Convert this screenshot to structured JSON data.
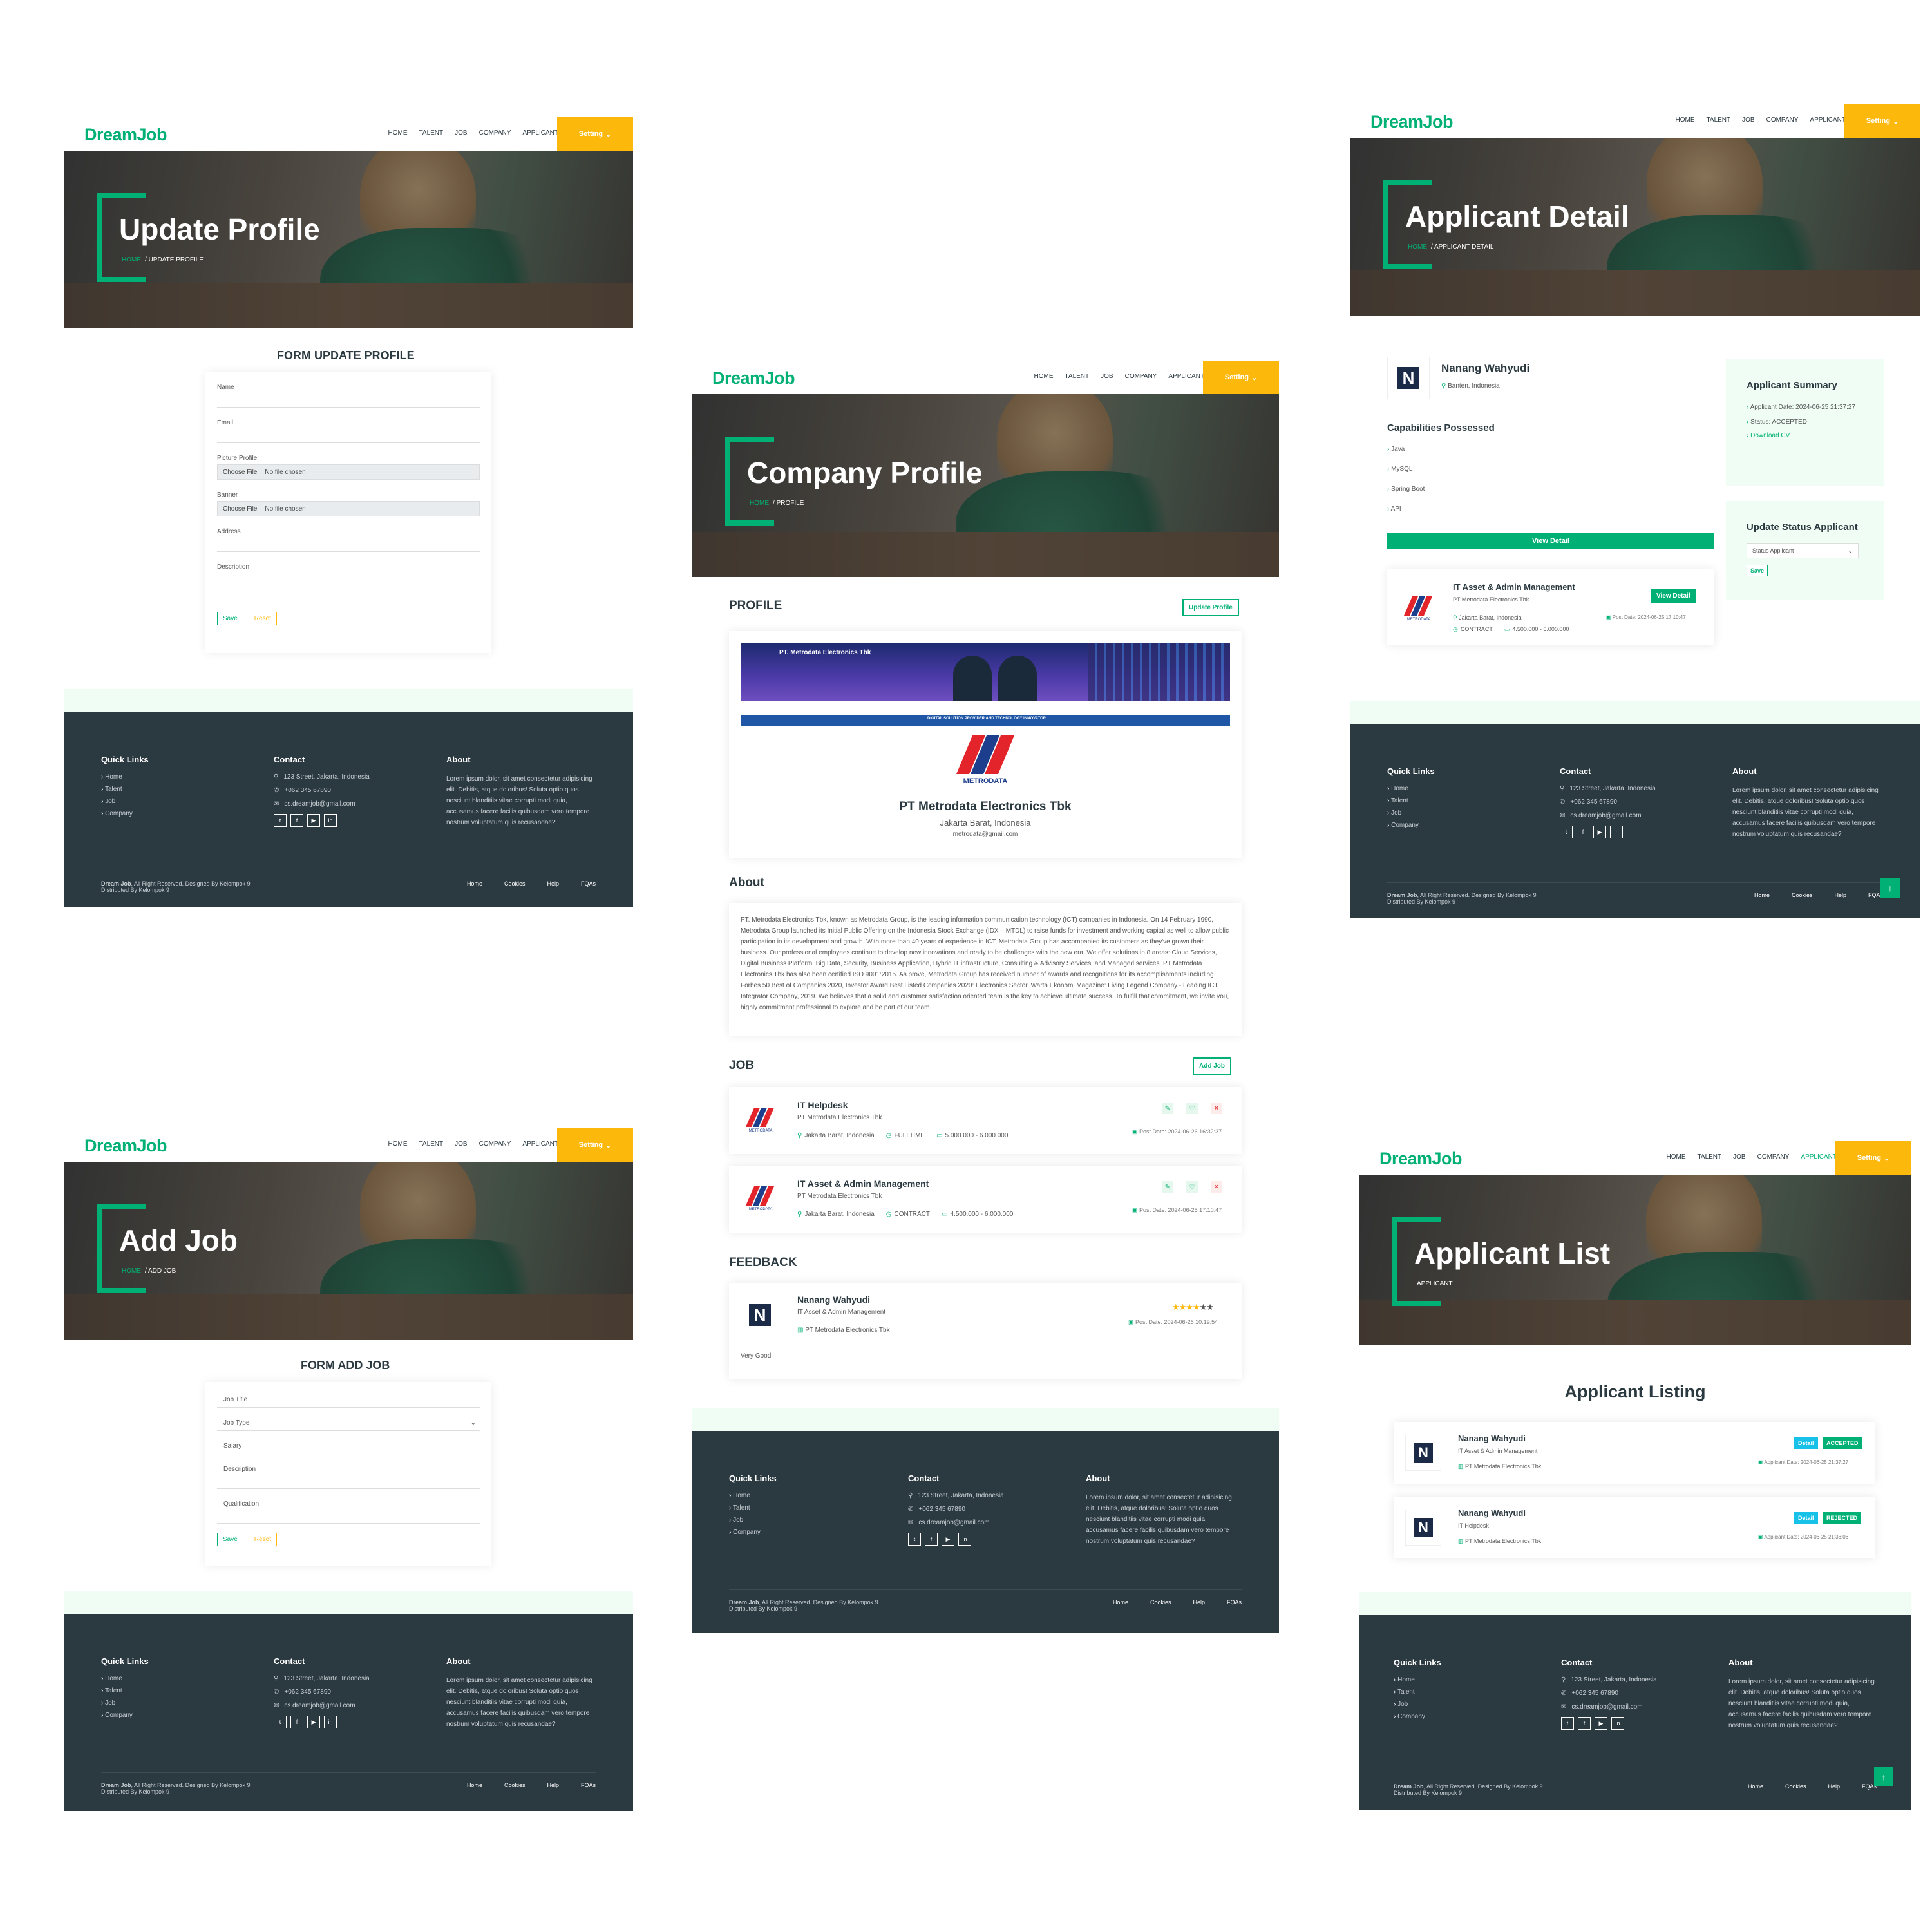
{
  "nav": {
    "logo": "DreamJob",
    "items": [
      "HOME",
      "TALENT",
      "JOB",
      "COMPANY",
      "APPLICANT"
    ],
    "setting": "Setting"
  },
  "footer": {
    "quick_links_title": "Quick Links",
    "quick_links": [
      "Home",
      "Talent",
      "Job",
      "Company"
    ],
    "contact_title": "Contact",
    "address": "123 Street, Jakarta, Indonesia",
    "phone": "+062 345 67890",
    "email": "cs.dreamjob@gmail.com",
    "about_title": "About",
    "about_text": "Lorem ipsum dolor, sit amet consectetur adipisicing elit. Debitis, atque doloribus! Soluta optio quos nesciunt blanditiis vitae corrupti modi quia, accusamus facere facilis quibusdam vero tempore nostrum voluptatum quis recusandae?",
    "copyright_brand": "Dream Job",
    "copyright_rest": ", All Right Reserved. Designed By Kelompok 9",
    "distributed": "Distributed By Kelompok 9",
    "bottom_links": [
      "Home",
      "Cookies",
      "Help",
      "FQAs"
    ]
  },
  "update_profile": {
    "title": "Update Profile",
    "crumb_home": "HOME",
    "crumb": "UPDATE PROFILE",
    "form_title": "FORM UPDATE PROFILE",
    "labels": {
      "name": "Name",
      "email": "Email",
      "picture": "Picture Profile",
      "banner": "Banner",
      "address": "Address",
      "description": "Description"
    },
    "choose_file": "Choose File",
    "no_file": "No file chosen",
    "save": "Save",
    "reset": "Reset"
  },
  "add_job": {
    "title": "Add Job",
    "crumb_home": "HOME",
    "crumb": "ADD JOB",
    "form_title": "FORM ADD JOB",
    "placeholders": {
      "job_title": "Job Title",
      "job_type": "Job Type",
      "salary": "Salary",
      "description": "Description",
      "qualification": "Qualification"
    },
    "save": "Save",
    "reset": "Reset"
  },
  "company_profile": {
    "title": "Company Profile",
    "crumb_home": "HOME",
    "crumb": "PROFILE",
    "profile_heading": "PROFILE",
    "update_btn": "Update Profile",
    "banner_company": "PT. Metrodata Electronics Tbk",
    "banner_tag": "DIGITAL SOLUTION PROVIDER AND TECHNOLOGY INNOVATOR",
    "logo_text": "METRODATA",
    "company_name": "PT Metrodata Electronics Tbk",
    "location": "Jakarta Barat, Indonesia",
    "email": "metrodata@gmail.com",
    "about_heading": "About",
    "about_text": "PT. Metrodata Electronics Tbk, known as Metrodata Group, is the leading information communication technology (ICT) companies in Indonesia. On 14 February 1990, Metrodata Group launched its Initial Public Offering on the Indonesia Stock Exchange (IDX – MTDL) to raise funds for investment and working capital as well to allow public participation in its development and growth. With more than 40 years of experience in ICT, Metrodata Group has accompanied its customers as they've grown their business. Our professional employees continue to develop new innovations and ready to be challenges with the new era. We offer solutions in 8 areas: Cloud Services, Digital Business Platform, Big Data, Security, Business Application, Hybrid IT infrastructure, Consulting & Advisory Services, and Managed services. PT Metrodata Electronics Tbk has also been certified ISO 9001:2015. As prove, Metrodata Group has received number of awards and recognitions for its accomplishments including Forbes 50 Best of Companies 2020, Investor Award Best Listed Companies 2020: Electronics Sector, Warta Ekonomi Magazine: Living Legend Company - Leading ICT Integrator Company, 2019. We believes that a solid and customer satisfaction oriented team is the key to achieve ultimate success. To fulfill that commitment, we invite you, highly commitment professional to explore and be part of our team.",
    "job_heading": "JOB",
    "add_job_btn": "Add Job",
    "jobs": [
      {
        "title": "IT Helpdesk",
        "company": "PT Metrodata Electronics Tbk",
        "location": "Jakarta Barat, Indonesia",
        "type": "FULLTIME",
        "salary": "5.000.000 - 6.000.000",
        "date": "Post Date: 2024-06-26 16:32:37"
      },
      {
        "title": "IT Asset & Admin Management",
        "company": "PT Metrodata Electronics Tbk",
        "location": "Jakarta Barat, Indonesia",
        "type": "CONTRACT",
        "salary": "4.500.000 - 6.000.000",
        "date": "Post Date: 2024-06-25 17:10:47"
      }
    ],
    "feedback_heading": "FEEDBACK",
    "feedback": {
      "name": "Nanang Wahyudi",
      "job": "IT Asset & Admin Management",
      "company": "PT Metrodata Electronics Tbk",
      "date": "Post Date: 2024-06-26 10:19:54",
      "rating": 4,
      "comment": "Very Good"
    }
  },
  "applicant_detail": {
    "title": "Applicant Detail",
    "crumb_home": "HOME",
    "crumb": "APPLICANT DETAIL",
    "name": "Nanang Wahyudi",
    "location": "Banten, Indonesia",
    "cap_heading": "Capabilities Possessed",
    "capabilities": [
      "Java",
      "MySQL",
      "Spring Boot",
      "API"
    ],
    "view_detail": "View Detail",
    "job": {
      "title": "IT Asset & Admin Management",
      "company": "PT Metrodata Electronics Tbk",
      "location": "Jakarta Barat, Indonesia",
      "type": "CONTRACT",
      "salary": "4.500.000 - 6.000.000",
      "date": "Post Date: 2024-06-25 17:10:47",
      "button": "View Detail"
    },
    "summary_heading": "Applicant Summary",
    "summary_date": "Applicant Date: 2024-06-25 21:37:27",
    "summary_status": "Status: ACCEPTED",
    "download_cv": "Download CV",
    "update_heading": "Update Status Applicant",
    "select_placeholder": "Status Applicant",
    "save": "Save"
  },
  "applicant_list": {
    "title": "Applicant List",
    "crumb": "APPLICANT",
    "listing_heading": "Applicant Listing",
    "items": [
      {
        "name": "Nanang Wahyudi",
        "job": "IT Asset & Admin Management",
        "company": "PT Metrodata Electronics Tbk",
        "date": "Applicant Date: 2024-06-25 21:37:27",
        "detail": "Detail",
        "status": "ACCEPTED",
        "status_color": "#00b074"
      },
      {
        "name": "Nanang Wahyudi",
        "job": "IT Helpdesk",
        "company": "PT Metrodata Electronics Tbk",
        "date": "Applicant Date: 2024-06-25 21:36:06",
        "detail": "Detail",
        "status": "REJECTED",
        "status_color": "#00b074"
      }
    ]
  },
  "colors": {
    "primary": "#00b074",
    "accent": "#fdb90b",
    "dark": "#2b3940",
    "light_band": "#effdf5",
    "info": "#17c1e8"
  }
}
